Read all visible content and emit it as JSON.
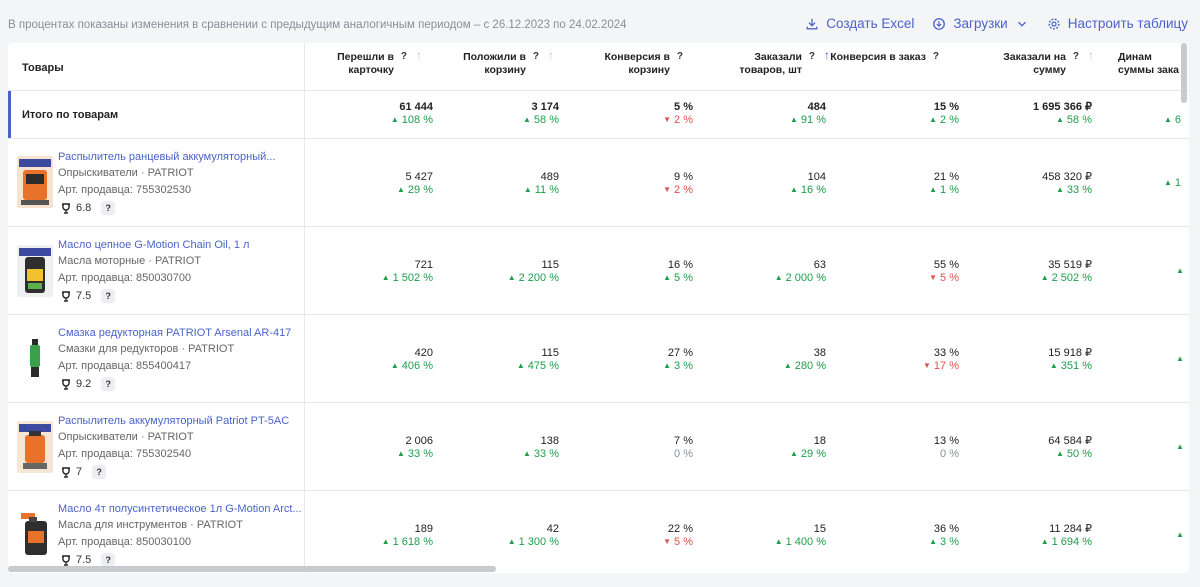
{
  "top": {
    "note": "В процентах показаны изменения в сравнении с предыдущим аналогичным периодом – с 26.12.2023 по 24.02.2024",
    "excel": "Создать Excel",
    "downloads": "Загрузки",
    "configure": "Настроить таблицу"
  },
  "header": {
    "products": "Товары",
    "columns": [
      {
        "label": "Перешли в\nкарточку",
        "q": "?",
        "arrow": "↑"
      },
      {
        "label": "Положили в\nкорзину",
        "q": "?",
        "arrow": "↑"
      },
      {
        "label": "Конверсия в\nкорзину",
        "q": "?",
        "arrow": ""
      },
      {
        "label": "Заказали\nтоваров, шт",
        "q": "?",
        "arrow": "↑"
      },
      {
        "label": "Конверсия в заказ",
        "q": "?",
        "arrow": ""
      },
      {
        "label": "Заказали на\nсумму",
        "q": "?",
        "arrow": "↑"
      },
      {
        "label": "Динам\nсуммы зака",
        "q": "",
        "arrow": ""
      }
    ]
  },
  "total": {
    "label": "Итого по товарам",
    "cells": [
      {
        "v": "61 444",
        "d": "108 %",
        "dir": "up"
      },
      {
        "v": "3 174",
        "d": "58 %",
        "dir": "up"
      },
      {
        "v": "5 %",
        "d": "2 %",
        "dir": "down"
      },
      {
        "v": "484",
        "d": "91 %",
        "dir": "up"
      },
      {
        "v": "15 %",
        "d": "2 %",
        "dir": "up"
      },
      {
        "v": "1 695 366 ₽",
        "d": "58 %",
        "dir": "up"
      },
      {
        "v": "",
        "d": "6",
        "dir": "up"
      }
    ]
  },
  "products": [
    {
      "name": "Распылитель ранцевый аккумуляторный...",
      "category": "Опрыскиватели · PATRIOT",
      "article": "Арт. продавца: 755302530",
      "rating": "6.8",
      "q": "?",
      "cells": [
        {
          "v": "5 427",
          "d": "29 %",
          "dir": "up"
        },
        {
          "v": "489",
          "d": "11 %",
          "dir": "up"
        },
        {
          "v": "9 %",
          "d": "2 %",
          "dir": "down"
        },
        {
          "v": "104",
          "d": "16 %",
          "dir": "up"
        },
        {
          "v": "21 %",
          "d": "1 %",
          "dir": "up"
        },
        {
          "v": "458 320 ₽",
          "d": "33 %",
          "dir": "up"
        },
        {
          "v": "",
          "d": "1",
          "dir": "up"
        }
      ]
    },
    {
      "name": "Масло цепное G-Motion Chain Oil, 1 л",
      "category": "Масла моторные · PATRIOT",
      "article": "Арт. продавца: 850030700",
      "rating": "7.5",
      "q": "?",
      "cells": [
        {
          "v": "721",
          "d": "1 502 %",
          "dir": "up"
        },
        {
          "v": "115",
          "d": "2 200 %",
          "dir": "up"
        },
        {
          "v": "16 %",
          "d": "5 %",
          "dir": "up"
        },
        {
          "v": "63",
          "d": "2 000 %",
          "dir": "up"
        },
        {
          "v": "55 %",
          "d": "5 %",
          "dir": "down"
        },
        {
          "v": "35 519 ₽",
          "d": "2 502 %",
          "dir": "up"
        },
        {
          "v": "",
          "d": "",
          "dir": "up"
        }
      ]
    },
    {
      "name": "Смазка редукторная PATRIOT Arsenal AR-417",
      "category": "Смазки для редукторов · PATRIOT",
      "article": "Арт. продавца: 855400417",
      "rating": "9.2",
      "q": "?",
      "cells": [
        {
          "v": "420",
          "d": "406 %",
          "dir": "up"
        },
        {
          "v": "115",
          "d": "475 %",
          "dir": "up"
        },
        {
          "v": "27 %",
          "d": "3 %",
          "dir": "up"
        },
        {
          "v": "38",
          "d": "280 %",
          "dir": "up"
        },
        {
          "v": "33 %",
          "d": "17 %",
          "dir": "down"
        },
        {
          "v": "15 918 ₽",
          "d": "351 %",
          "dir": "up"
        },
        {
          "v": "",
          "d": "",
          "dir": "up"
        }
      ]
    },
    {
      "name": "Распылитель аккумуляторный Patriot PT-5AC",
      "category": "Опрыскиватели · PATRIOT",
      "article": "Арт. продавца: 755302540",
      "rating": "7",
      "q": "?",
      "cells": [
        {
          "v": "2 006",
          "d": "33 %",
          "dir": "up"
        },
        {
          "v": "138",
          "d": "33 %",
          "dir": "up"
        },
        {
          "v": "7 %",
          "d": "0 %",
          "dir": "zero"
        },
        {
          "v": "18",
          "d": "29 %",
          "dir": "up"
        },
        {
          "v": "13 %",
          "d": "0 %",
          "dir": "zero"
        },
        {
          "v": "64 584 ₽",
          "d": "50 %",
          "dir": "up"
        },
        {
          "v": "",
          "d": "",
          "dir": "up"
        }
      ]
    },
    {
      "name": "Масло 4т полусинтетическое 1л G-Motion Arct...",
      "category": "Масла для инструментов · PATRIOT",
      "article": "Арт. продавца: 850030100",
      "rating": "7.5",
      "q": "?",
      "cells": [
        {
          "v": "189",
          "d": "1 618 %",
          "dir": "up"
        },
        {
          "v": "42",
          "d": "1 300 %",
          "dir": "up"
        },
        {
          "v": "22 %",
          "d": "5 %",
          "dir": "down"
        },
        {
          "v": "15",
          "d": "1 400 %",
          "dir": "up"
        },
        {
          "v": "36 %",
          "d": "3 %",
          "dir": "up"
        },
        {
          "v": "11 284 ₽",
          "d": "1 694 %",
          "dir": "up"
        },
        {
          "v": "",
          "d": "",
          "dir": "up"
        }
      ]
    }
  ]
}
